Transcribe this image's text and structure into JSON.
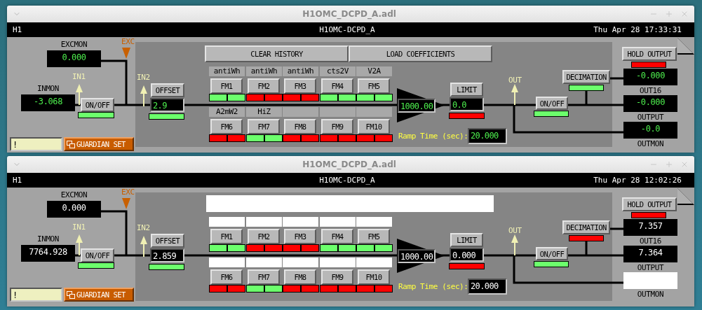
{
  "windows": [
    {
      "title": "H1OMC_DCPD_A.adl",
      "site": "H1",
      "screen": "H1OMC-DCPD_A",
      "datetime": "Thu Apr 28 17:33:31",
      "alarm_colors": true,
      "excmon": {
        "label": "EXCMON",
        "value": "0.000"
      },
      "inmon": {
        "label": "INMON",
        "value": "-3.068"
      },
      "ports": {
        "exc": "EXC",
        "in1": "IN1",
        "in2": "IN2",
        "out": "OUT"
      },
      "input_switch": {
        "label": "ON/OFF",
        "on": true
      },
      "offset": {
        "label": "OFFSET",
        "value": "2.9",
        "on": true
      },
      "history_buttons": {
        "connected": true,
        "labels": [
          "CLEAR HISTORY",
          "LOAD COEFFICIENTS"
        ]
      },
      "filters": [
        {
          "button": "FM1",
          "label": "antiWh",
          "label_connected": true,
          "indicators": [
            {
              "on": true
            },
            {
              "on": true
            }
          ]
        },
        {
          "button": "FM2",
          "label": "antiWh",
          "label_connected": true,
          "indicators": [
            {
              "on": false
            },
            {
              "on": false
            }
          ]
        },
        {
          "button": "FM3",
          "label": "antiWh",
          "label_connected": true,
          "indicators": [
            {
              "on": false
            },
            {
              "on": false
            }
          ]
        },
        {
          "button": "FM4",
          "label": "cts2V",
          "label_connected": true,
          "indicators": [
            {
              "on": true
            },
            {
              "on": true
            }
          ]
        },
        {
          "button": "FM5",
          "label": "V2A",
          "label_connected": true,
          "indicators": [
            {
              "on": true
            },
            {
              "on": true
            }
          ]
        },
        {
          "button": "FM6",
          "label": "A2mW2",
          "label_connected": true,
          "indicators": [
            {
              "on": false
            },
            {
              "on": false
            }
          ]
        },
        {
          "button": "FM7",
          "label": "HiZ",
          "label_connected": true,
          "indicators": [
            {
              "on": true
            },
            {
              "on": true
            }
          ]
        },
        {
          "button": "FM8",
          "label_connected": true,
          "indicators": [
            {
              "on": false
            },
            {
              "on": false
            }
          ]
        },
        {
          "button": "FM9",
          "label_connected": true,
          "indicators": [
            {
              "on": false
            },
            {
              "on": false
            }
          ]
        },
        {
          "button": "FM10",
          "label_connected": true,
          "indicators": [
            {
              "on": false
            },
            {
              "on": false
            }
          ]
        }
      ],
      "gain": {
        "value": "1000.00"
      },
      "limit": {
        "label": "LIMIT",
        "value": "0.0",
        "on": false
      },
      "ramp": {
        "label": "Ramp Time (sec):",
        "value": "20.000"
      },
      "output_switch": {
        "label": "ON/OFF",
        "on": true
      },
      "decimation": {
        "label": "DECIMATION",
        "on": true
      },
      "hold_output": {
        "label": "HOLD OUTPUT",
        "on": false
      },
      "out16": {
        "label": "OUT16",
        "value": "-0.000"
      },
      "output": {
        "label": "OUTPUT",
        "value": "-0.000"
      },
      "outmon": {
        "label": "OUTMON",
        "value": "-0.0"
      },
      "message": {
        "value": "!"
      },
      "guardian_button": "GUARDIAN SET"
    },
    {
      "title": "H1OMC_DCPD_A.adl",
      "site": "H1",
      "screen": "H1OMC-DCPD_A",
      "datetime": "Thu Apr 28 12:02:26",
      "alarm_colors": false,
      "excmon": {
        "label": "EXCMON",
        "value": "0.000"
      },
      "inmon": {
        "label": "INMON",
        "value": "7764.928"
      },
      "ports": {
        "exc": "EXC",
        "in1": "IN1",
        "in2": "IN2",
        "out": "OUT"
      },
      "input_switch": {
        "label": "ON/OFF",
        "on": true
      },
      "offset": {
        "label": "OFFSET",
        "value": "2.859",
        "on": true
      },
      "history_buttons": {
        "connected": false
      },
      "filters": [
        {
          "button": "FM1",
          "label_connected": false,
          "indicators": [
            {
              "on": true
            },
            {
              "on": true
            }
          ]
        },
        {
          "button": "FM2",
          "label_connected": false,
          "indicators": [
            {
              "on": false
            },
            {
              "on": false
            }
          ]
        },
        {
          "button": "FM3",
          "label_connected": false,
          "indicators": [
            {
              "on": false
            },
            {
              "on": false
            }
          ]
        },
        {
          "button": "FM4",
          "label_connected": false,
          "indicators": [
            {
              "on": true
            },
            {
              "on": true
            }
          ]
        },
        {
          "button": "FM5",
          "label_connected": false,
          "indicators": [
            {
              "on": true
            },
            {
              "on": true
            }
          ]
        },
        {
          "button": "FM6",
          "label_connected": false,
          "indicators": [
            {
              "on": false
            },
            {
              "on": false
            }
          ]
        },
        {
          "button": "FM7",
          "label_connected": false,
          "indicators": [
            {
              "on": true
            },
            {
              "on": true
            }
          ]
        },
        {
          "button": "FM8",
          "label_connected": false,
          "indicators": [
            {
              "on": false
            },
            {
              "on": false
            }
          ]
        },
        {
          "button": "FM9",
          "label_connected": false,
          "indicators": [
            {
              "on": false
            },
            {
              "on": false
            }
          ]
        },
        {
          "button": "FM10",
          "label_connected": false,
          "indicators": [
            {
              "on": false
            },
            {
              "on": false
            }
          ]
        }
      ],
      "gain": {
        "value": "1000.00"
      },
      "limit": {
        "label": "LIMIT",
        "value": "0.000",
        "on": false
      },
      "ramp": {
        "label": "Ramp Time (sec):",
        "value": "20.000"
      },
      "output_switch": {
        "label": "ON/OFF",
        "on": true
      },
      "decimation": {
        "label": "DECIMATION",
        "on": false
      },
      "hold_output": {
        "label": "HOLD OUTPUT",
        "on": false
      },
      "out16": {
        "label": "OUT16",
        "value": "7.357"
      },
      "output": {
        "label": "OUTPUT",
        "value": "7.364"
      },
      "outmon": {
        "label": "OUTMON",
        "connected": false
      },
      "message": {
        "value": "!"
      },
      "guardian_button": "GUARDIAN SET"
    }
  ]
}
